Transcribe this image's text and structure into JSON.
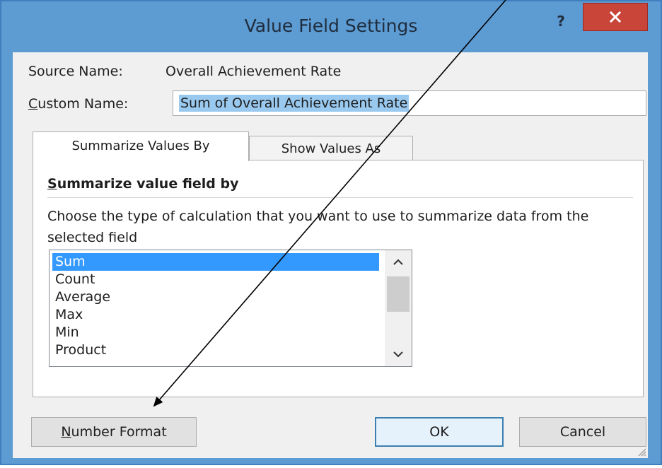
{
  "dialog": {
    "title": "Value Field Settings",
    "help_label": "?",
    "close_icon": "close-x-icon"
  },
  "source": {
    "label": "Source Name:",
    "value": "Overall Achievement Rate"
  },
  "custom_name": {
    "label_accel": "C",
    "label_rest": "ustom Name:",
    "value": "Sum of Overall Achievement Rate"
  },
  "tabs": [
    {
      "label": "Summarize Values By",
      "active": true
    },
    {
      "label": "Show Values As",
      "active": false
    }
  ],
  "panel": {
    "section_title_accel": "S",
    "section_title_rest": "ummarize value field by",
    "description": "Choose the type of calculation that you want to use to summarize data from the selected field",
    "items": [
      "Sum",
      "Count",
      "Average",
      "Max",
      "Min",
      "Product"
    ],
    "selected": "Sum"
  },
  "buttons": {
    "number_format_accel": "N",
    "number_format_rest": "umber Format",
    "ok": "OK",
    "cancel": "Cancel"
  },
  "colors": {
    "frame": "#5d9bd3",
    "close": "#c9453a",
    "selection": "#3399ff",
    "input_highlight": "#99c9ef"
  }
}
